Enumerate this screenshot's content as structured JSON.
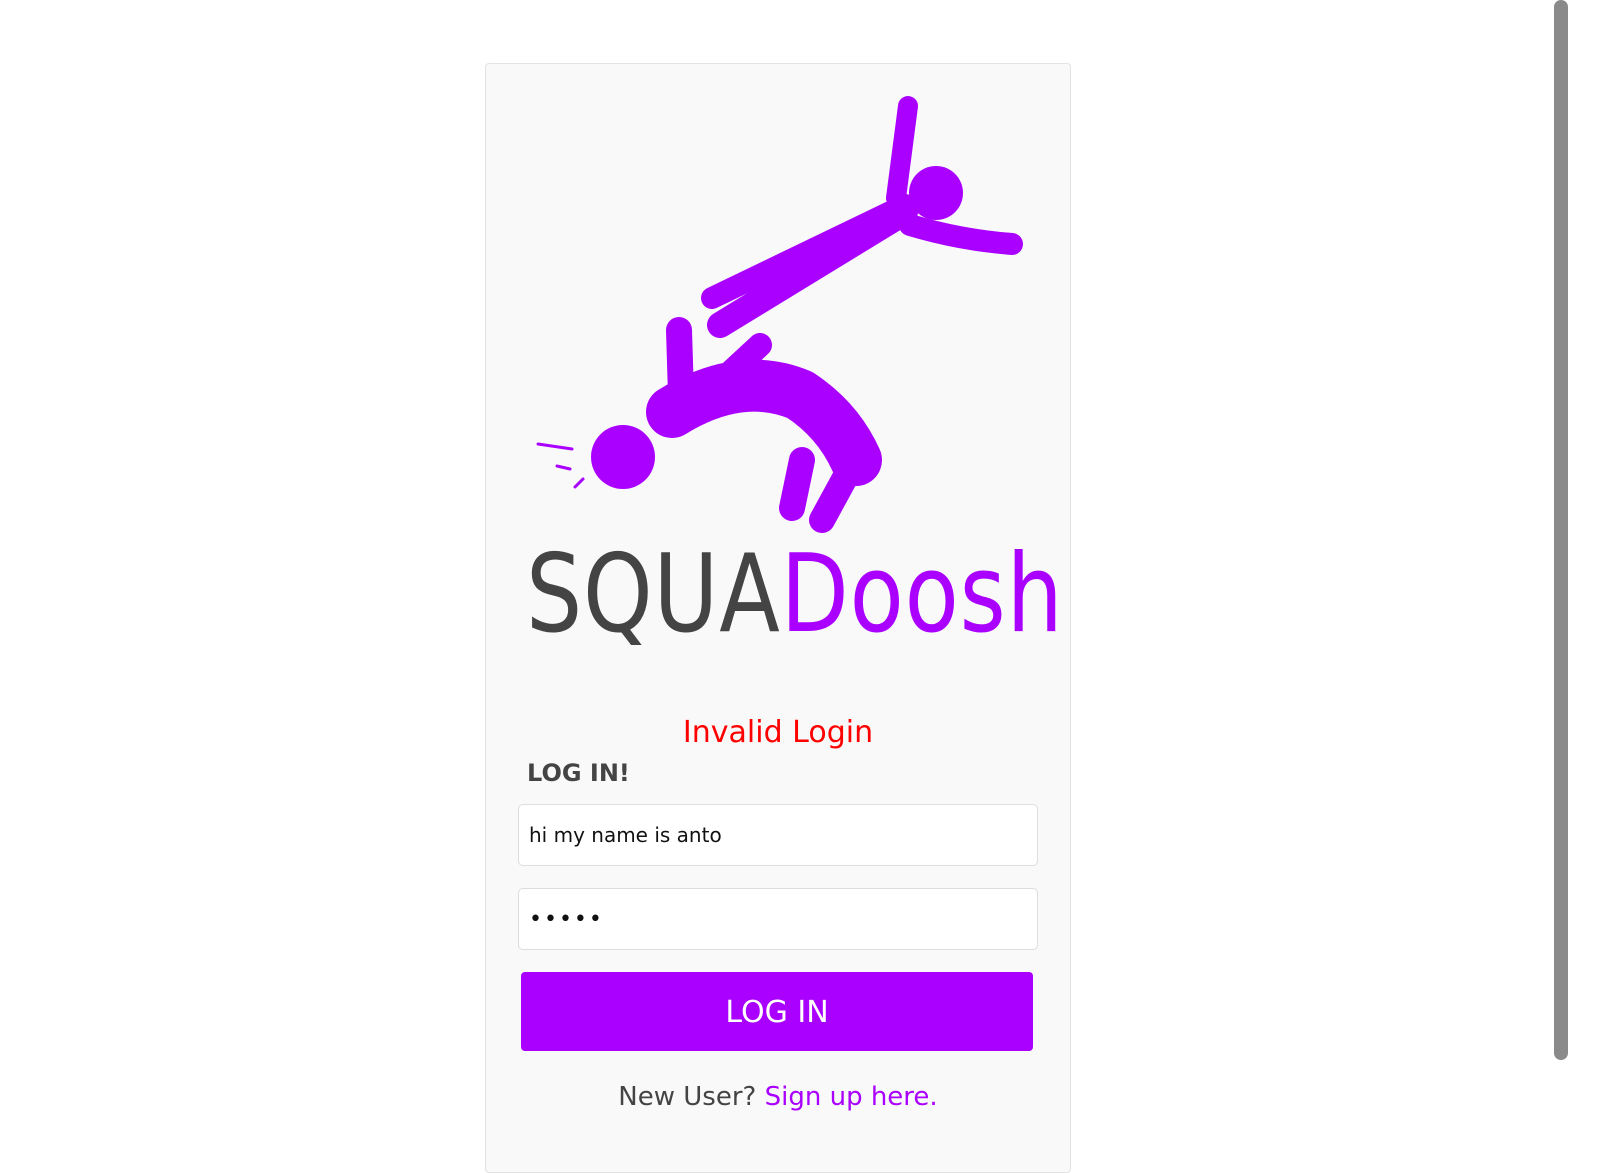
{
  "brand": {
    "name_part1": "SQUA",
    "name_part2": "Doosh",
    "accent_color": "#aa00ff",
    "dark_color": "#444444"
  },
  "login": {
    "error_message": "Invalid Login",
    "error_color": "#ff0000",
    "title": "LOG IN!",
    "username_value": "hi my name is anto",
    "password_value": "•••••",
    "submit_label": "LOG IN",
    "signup_prompt": "New User?",
    "signup_link": "Sign up here."
  },
  "icons": {
    "logo": "falling-stick-figures-logo"
  }
}
